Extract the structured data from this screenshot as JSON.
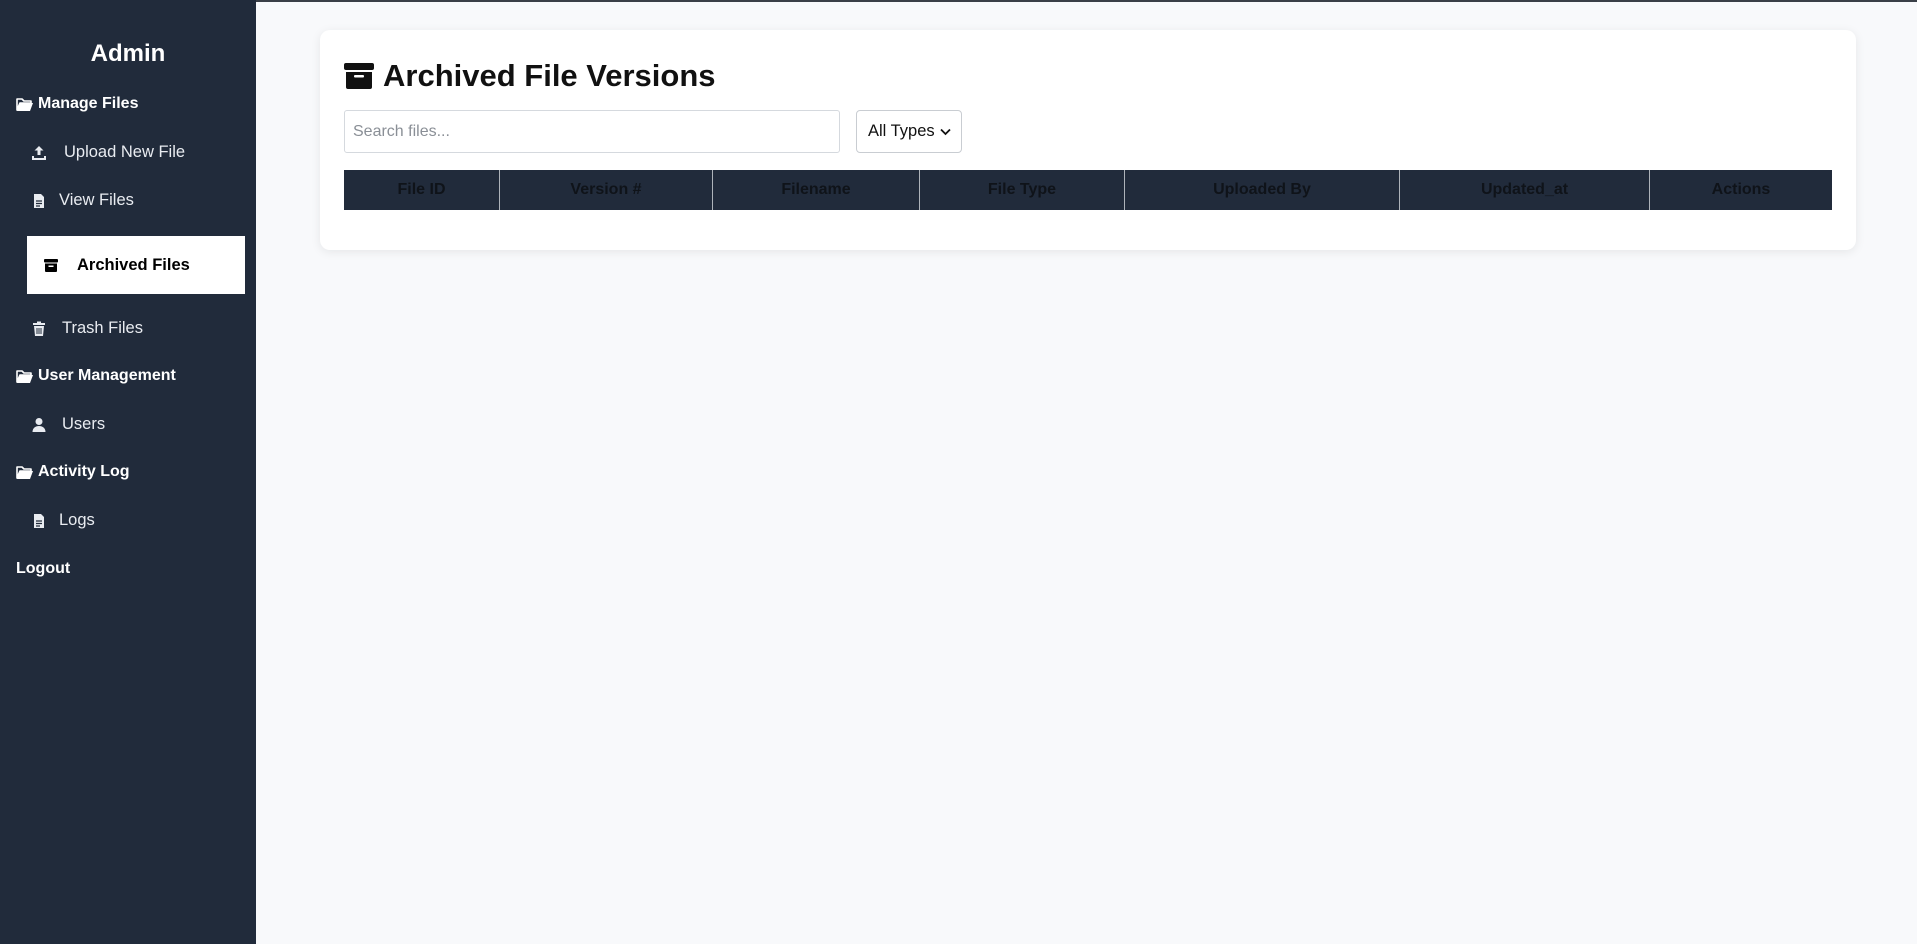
{
  "sidebar": {
    "brand": "Admin",
    "sections": {
      "manage_files": "Manage Files",
      "user_management": "User Management",
      "activity_log": "Activity Log"
    },
    "items": {
      "upload": "Upload New File",
      "view": "View Files",
      "archived": "Archived Files",
      "trash": "Trash Files",
      "users": "Users",
      "logs": "Logs"
    },
    "logout": "Logout",
    "active_item": "Archived Files"
  },
  "main": {
    "title": "Archived File Versions",
    "search": {
      "placeholder": "Search files...",
      "value": ""
    },
    "filter": {
      "selected": "All Types"
    },
    "table": {
      "columns": [
        "File ID",
        "Version #",
        "Filename",
        "File Type",
        "Uploaded By",
        "Updated_at",
        "Actions"
      ],
      "rows": []
    }
  },
  "colors": {
    "sidebar_bg": "#212b3b",
    "page_bg": "#f8f9fb",
    "table_header_bg": "#212b3b",
    "active_item_bg": "#ffffff"
  },
  "icons": {
    "section": "folder-open-icon",
    "upload": "upload-icon",
    "view": "file-icon",
    "archived": "archive-box-icon",
    "trash": "trash-icon",
    "users": "user-icon",
    "logs": "file-icon",
    "title": "archive-box-icon"
  }
}
